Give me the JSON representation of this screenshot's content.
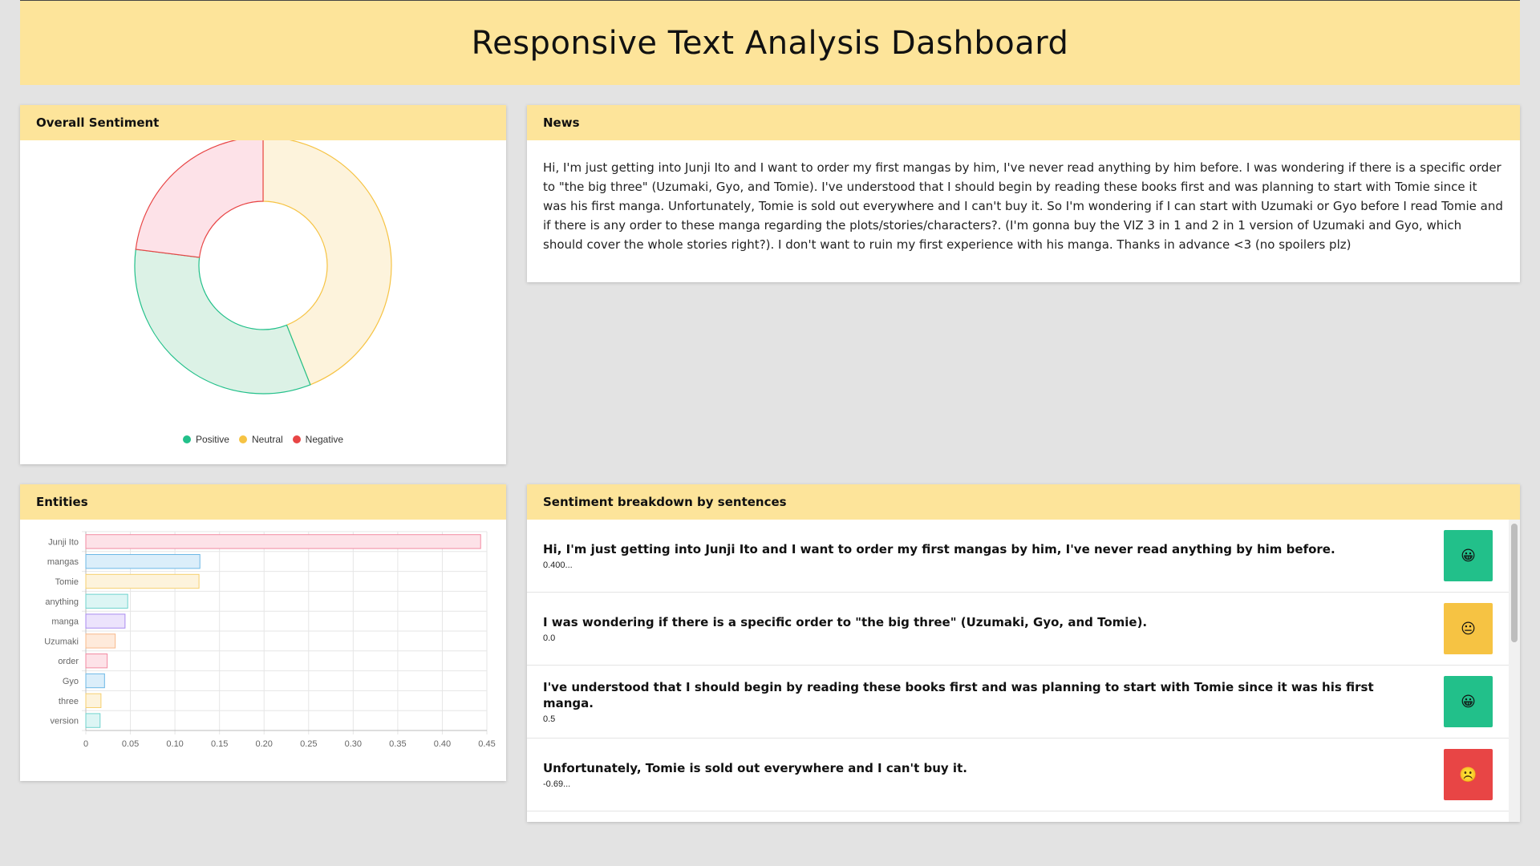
{
  "header": {
    "title": "Responsive Text Analysis Dashboard"
  },
  "cards": {
    "overall_sentiment": {
      "title": "Overall Sentiment"
    },
    "news": {
      "title": "News",
      "text": "Hi, I'm just getting into Junji Ito and I want to order my first mangas by him, I've never read anything by him before. I was wondering if there is a specific order to \"the big three\" (Uzumaki, Gyo, and Tomie). I've understood that I should begin by reading these books first and was planning to start with Tomie since it was his first manga. Unfortunately, Tomie is sold out everywhere and I can't buy it. So I'm wondering if I can start with Uzumaki or Gyo before I read Tomie and if there is any order to these manga regarding the plots/stories/characters?. (I'm gonna buy the VIZ 3 in 1 and 2 in 1 version of Uzumaki and Gyo, which should cover the whole stories right?). I don't want to ruin my first experience with his manga. Thanks in advance <3 (no spoilers plz)"
    },
    "entities": {
      "title": "Entities"
    },
    "breakdown": {
      "title": "Sentiment breakdown by sentences"
    }
  },
  "legend": [
    {
      "label": "Positive",
      "color": "#22c08a"
    },
    {
      "label": "Neutral",
      "color": "#f6c343"
    },
    {
      "label": "Negative",
      "color": "#e84545"
    }
  ],
  "breakdown_rows": [
    {
      "sentence": "Hi, I'm just getting into Junji Ito and I want to order my first mangas by him, I've never read anything by him before.",
      "score": "0.400...",
      "sentiment": "positive",
      "face": "😀"
    },
    {
      "sentence": "I was wondering if there is a specific order to \"the big three\" (Uzumaki, Gyo, and Tomie).",
      "score": "0.0",
      "sentiment": "neutral",
      "face": "😐"
    },
    {
      "sentence": "I've understood that I should begin by reading these books first and was planning to start with Tomie since it was his first manga.",
      "score": "0.5",
      "sentiment": "positive",
      "face": "😀"
    },
    {
      "sentence": "Unfortunately, Tomie is sold out everywhere and I can't buy it.",
      "score": "-0.69...",
      "sentiment": "negative",
      "face": "☹️"
    }
  ],
  "sentiment_colors": {
    "positive": "#22c08a",
    "neutral": "#f6c343",
    "negative": "#e84545"
  },
  "chart_data": [
    {
      "type": "pie",
      "variant": "doughnut",
      "categories": [
        "Positive",
        "Neutral",
        "Negative"
      ],
      "values": [
        33,
        44,
        23
      ],
      "fill_colors": [
        "#dcf2e6",
        "#fdf3dc",
        "#fde2e8"
      ],
      "stroke_colors": [
        "#22c08a",
        "#f6c343",
        "#e84545"
      ],
      "legend": "bottom"
    },
    {
      "type": "bar",
      "orientation": "horizontal",
      "categories": [
        "Junji Ito",
        "mangas",
        "Tomie",
        "anything",
        "manga",
        "Uzumaki",
        "order",
        "Gyo",
        "three",
        "version"
      ],
      "values": [
        0.443,
        0.128,
        0.127,
        0.047,
        0.044,
        0.033,
        0.024,
        0.021,
        0.017,
        0.016
      ],
      "fill_colors": [
        "#fde2e8",
        "#dbeefa",
        "#fdf3dc",
        "#dcf5f4",
        "#ece3fc",
        "#feeadb",
        "#fde2e8",
        "#dbeefa",
        "#fdf3dc",
        "#dcf5f4"
      ],
      "stroke_colors": [
        "#f28aa2",
        "#6cb8e6",
        "#f6cf6e",
        "#6fd3cd",
        "#a98af0",
        "#f8b98a",
        "#f28aa2",
        "#6cb8e6",
        "#f6cf6e",
        "#6fd3cd"
      ],
      "xlim": [
        0,
        0.45
      ],
      "xticks": [
        "0",
        "0.05",
        "0.10",
        "0.15",
        "0.20",
        "0.25",
        "0.30",
        "0.35",
        "0.40",
        "0.45"
      ],
      "grid": true
    }
  ]
}
